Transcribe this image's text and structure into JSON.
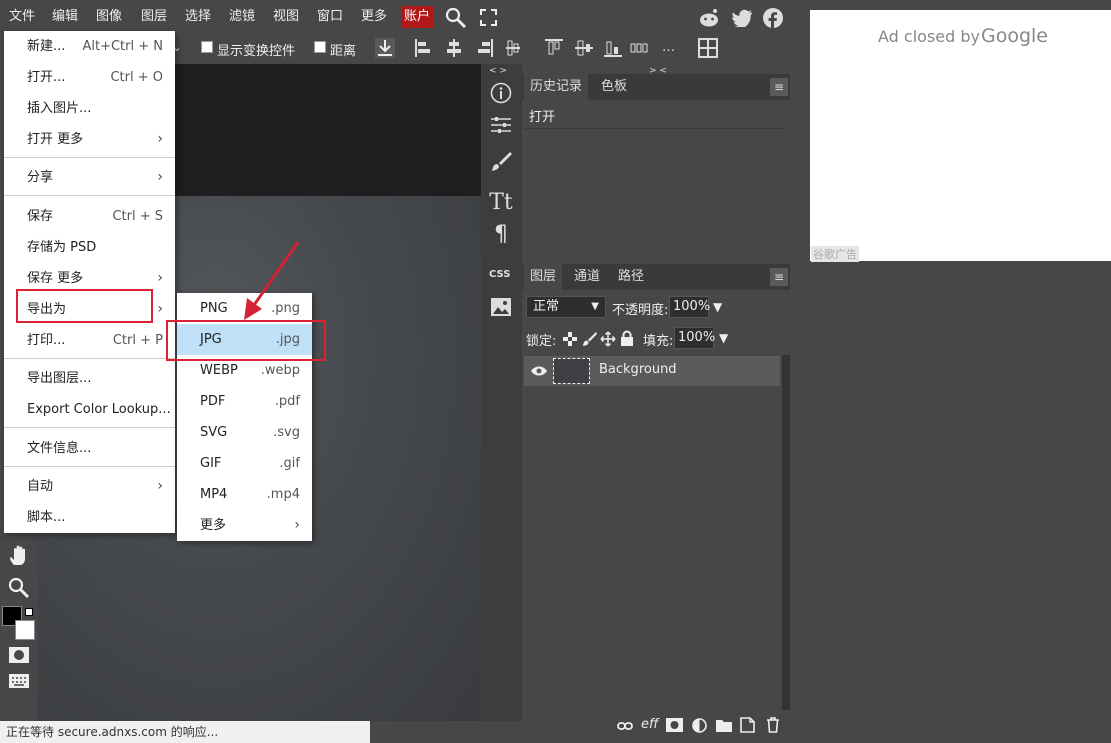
{
  "menubar": {
    "items": [
      "文件",
      "编辑",
      "图像",
      "图层",
      "选择",
      "滤镜",
      "视图",
      "窗口",
      "更多",
      "账户"
    ]
  },
  "options": {
    "show_transform": "显示变换控件",
    "distance": "距离"
  },
  "file_menu": {
    "items": [
      {
        "label": "新建...",
        "shortcut": "Alt+Ctrl + N"
      },
      {
        "label": "打开...",
        "shortcut": "Ctrl + O"
      },
      {
        "label": "插入图片..."
      },
      {
        "label": "打开 更多"
      },
      {
        "label": "分享"
      },
      {
        "label": "保存",
        "shortcut": "Ctrl + S"
      },
      {
        "label": "存储为 PSD"
      },
      {
        "label": "保存 更多"
      },
      {
        "label": "导出为"
      },
      {
        "label": "打印...",
        "shortcut": "Ctrl + P"
      },
      {
        "label": "导出图层..."
      },
      {
        "label": "Export Color Lookup..."
      },
      {
        "label": "文件信息..."
      },
      {
        "label": "自动"
      },
      {
        "label": "脚本..."
      }
    ]
  },
  "export_menu": {
    "items": [
      {
        "label": "PNG",
        "ext": ".png"
      },
      {
        "label": "JPG",
        "ext": ".jpg"
      },
      {
        "label": "WEBP",
        "ext": ".webp"
      },
      {
        "label": "PDF",
        "ext": ".pdf"
      },
      {
        "label": "SVG",
        "ext": ".svg"
      },
      {
        "label": "GIF",
        "ext": ".gif"
      },
      {
        "label": "MP4",
        "ext": ".mp4"
      },
      {
        "label": "更多"
      }
    ]
  },
  "history_panel": {
    "tabs": [
      "历史记录",
      "色板"
    ],
    "entries": [
      "打开"
    ],
    "collapse_left": "< >",
    "collapse_right": "> <"
  },
  "layers_panel": {
    "tabs": [
      "图层",
      "通道",
      "路径"
    ],
    "blend_mode": "正常",
    "opacity_label": "不透明度:",
    "opacity": "100%",
    "lock_label": "锁定:",
    "fill_label": "填充:",
    "fill": "100%",
    "layers": [
      {
        "name": "Background"
      }
    ],
    "footer_eff": "eff"
  },
  "strip": {
    "css": "CSS"
  },
  "ad": {
    "text": "Ad closed by",
    "brand": "Google",
    "footer": "谷歌广告"
  },
  "status": {
    "text": "正在等待 secure.adnxs.com 的响应..."
  },
  "colors": {
    "accent_red": "#d22233",
    "menu_account": "#b01818",
    "selected_item": "#bfe0f7"
  }
}
